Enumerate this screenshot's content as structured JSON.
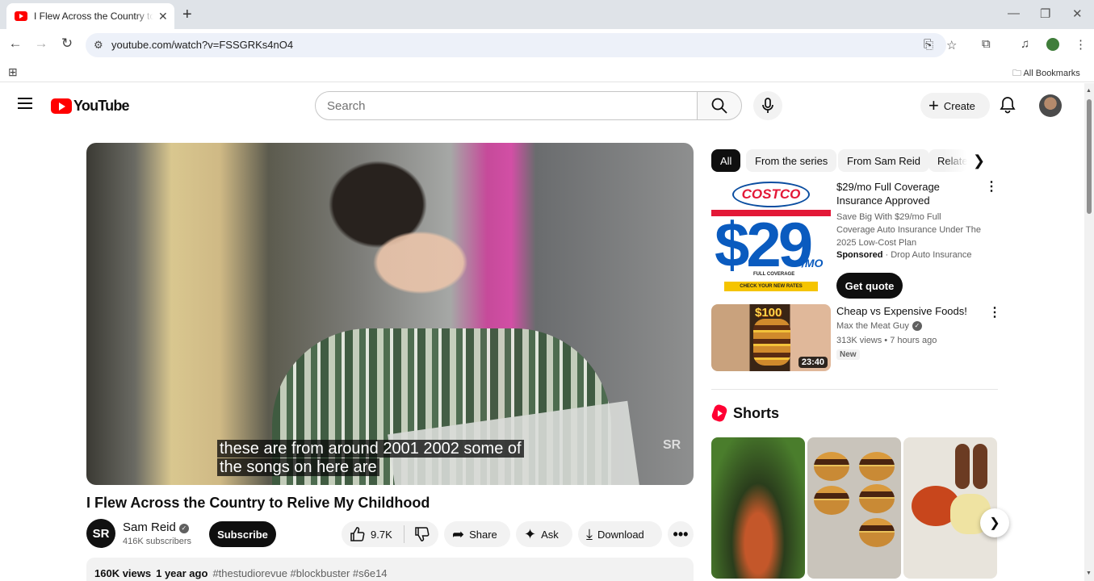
{
  "browser": {
    "tab_title": "I Flew Across the Country to Relive My Childhood",
    "url": "youtube.com/watch?v=FSSGRKs4nO4",
    "all_bookmarks": "All Bookmarks"
  },
  "masthead": {
    "logo_text": "YouTube",
    "search_placeholder": "Search",
    "create_label": "Create"
  },
  "player": {
    "caption_line1": "these are from around 2001 2002 some of",
    "caption_line2": "the songs on here are",
    "watermark": "SR"
  },
  "video": {
    "title": "I Flew Across the Country to Relive My Childhood",
    "channel_initials": "SR",
    "channel_name": "Sam Reid",
    "subscribers": "416K subscribers",
    "subscribe_label": "Subscribe",
    "likes": "9.7K",
    "share_label": "Share",
    "ask_label": "Ask",
    "download_label": "Download",
    "views": "160K views",
    "age": "1 year ago",
    "tags": "#thestudiorevue #blockbuster #s6e14"
  },
  "chips": [
    "All",
    "From the series",
    "From Sam Reid",
    "Related"
  ],
  "ad": {
    "brand": "COSTCO",
    "price": "$29",
    "per": "/MO",
    "coverage": "FULL COVERAGE",
    "check": "CHECK YOUR NEW RATES",
    "title": "$29/mo Full Coverage Insurance Approved",
    "description": "Save Big With $29/mo Full Coverage Auto Insurance Under The 2025 Low-Cost Plan",
    "sponsored": "Sponsored",
    "advertiser": "Drop Auto Insurance",
    "cta": "Get quote"
  },
  "recommendation": {
    "badge": "$100",
    "duration": "23:40",
    "title": "Cheap vs Expensive Foods!",
    "channel": "Max the Meat Guy",
    "meta": "313K views • 7 hours ago",
    "new_badge": "New"
  },
  "shorts": {
    "title": "Shorts"
  }
}
